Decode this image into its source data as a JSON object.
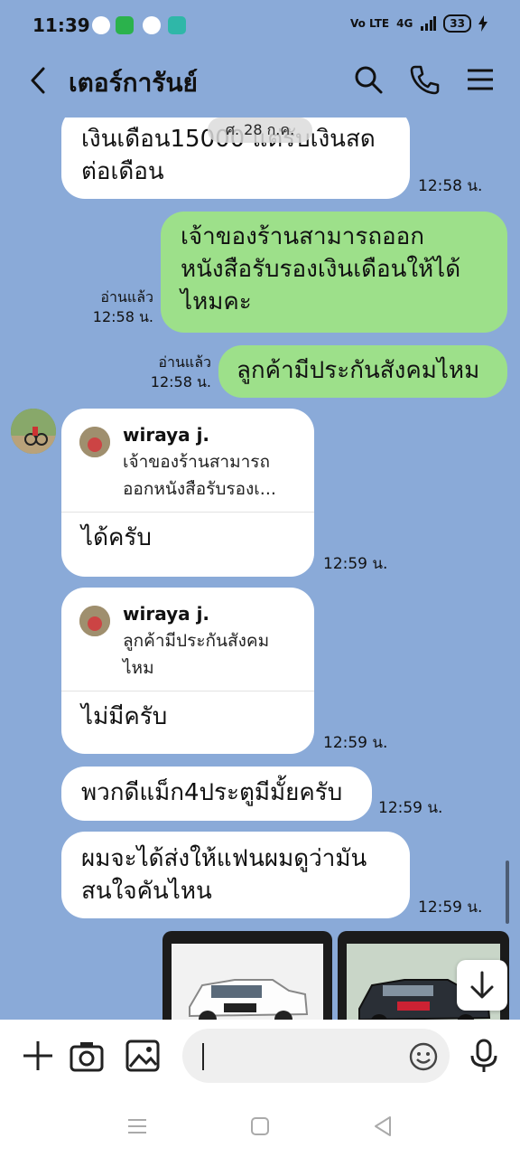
{
  "status_bar": {
    "time": "11:39",
    "network": "4G",
    "volte": "Vo LTE",
    "battery": "33"
  },
  "header": {
    "contact_name": "เตอร์การันย์",
    "icons": [
      "back-icon",
      "search-icon",
      "phone-icon",
      "menu-icon"
    ]
  },
  "date_separator": "ศ. 28 ก.ค.",
  "messages": [
    {
      "id": "m1",
      "direction": "in",
      "text_line1": "เงินเดือน15000 แต่รับเงินสด",
      "text_line2": "ต่อเดือน",
      "time": "12:58 น."
    },
    {
      "id": "m2",
      "direction": "out",
      "text_line1": "เจ้าของร้านสามารถออก",
      "text_line2": "หนังสือรับรองเงินเดือนให้ได้",
      "text_line3": "ไหมคะ",
      "read": "อ่านแล้ว",
      "time": "12:58 น."
    },
    {
      "id": "m3",
      "direction": "out",
      "text": "ลูกค้ามีประกันสังคมไหม",
      "read": "อ่านแล้ว",
      "time": "12:58 น."
    },
    {
      "id": "m4",
      "direction": "in",
      "reply_to_name": "wiraya j.",
      "reply_to_line1": "เจ้าของร้านสามารถ",
      "reply_to_line2": "ออกหนังสือรับรองเ...",
      "text": "ได้ครับ",
      "time": "12:59 น."
    },
    {
      "id": "m5",
      "direction": "in",
      "reply_to_name": "wiraya j.",
      "reply_to_line1": "ลูกค้ามีประกันสังคม",
      "reply_to_line2": "ไหม",
      "text": "ไม่มีครับ",
      "time": "12:59 น."
    },
    {
      "id": "m6",
      "direction": "in",
      "text": "พวกดีแม็ก4ประตูมีมั้ยครับ",
      "time": "12:59 น."
    },
    {
      "id": "m7",
      "direction": "in",
      "text_line1": "ผมจะได้ส่งให้แฟนผมดูว่ามัน",
      "text_line2": "สนใจคันไหน",
      "time": "12:59 น."
    }
  ],
  "input": {
    "placeholder": "",
    "icons": [
      "plus-icon",
      "camera-icon",
      "image-icon",
      "emoji-icon",
      "mic-icon"
    ]
  },
  "colors": {
    "chat_background": "#8aaad8",
    "outgoing_bubble": "#9de08a",
    "incoming_bubble": "#ffffff"
  }
}
